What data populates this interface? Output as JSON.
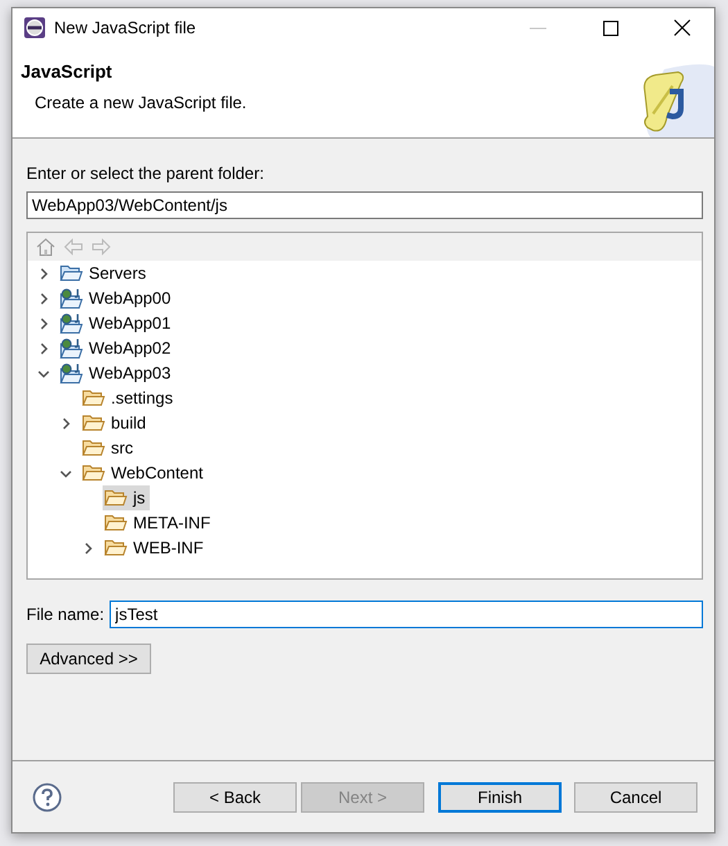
{
  "window": {
    "title": "New JavaScript file",
    "minimize_disabled": true
  },
  "header": {
    "title": "JavaScript",
    "description": "Create a new JavaScript file."
  },
  "parent_folder": {
    "label": "Enter or select the parent folder:",
    "value": "WebApp03/WebContent/js"
  },
  "tree": [
    {
      "name": "Servers",
      "kind": "server_folder",
      "expanded": false,
      "selected": false
    },
    {
      "name": "WebApp00",
      "kind": "project",
      "expanded": false,
      "selected": false
    },
    {
      "name": "WebApp01",
      "kind": "project",
      "expanded": false,
      "selected": false
    },
    {
      "name": "WebApp02",
      "kind": "project",
      "expanded": false,
      "selected": false
    },
    {
      "name": "WebApp03",
      "kind": "project",
      "expanded": true,
      "selected": false,
      "children": [
        {
          "name": ".settings",
          "kind": "folder",
          "selected": false
        },
        {
          "name": "build",
          "kind": "folder",
          "expanded": false,
          "selected": false
        },
        {
          "name": "src",
          "kind": "folder",
          "selected": false
        },
        {
          "name": "WebContent",
          "kind": "folder",
          "expanded": true,
          "selected": false,
          "children": [
            {
              "name": "js",
              "kind": "folder",
              "selected": true
            },
            {
              "name": "META-INF",
              "kind": "folder",
              "selected": false
            },
            {
              "name": "WEB-INF",
              "kind": "folder",
              "expanded": false,
              "selected": false
            }
          ]
        }
      ]
    }
  ],
  "file_name": {
    "label": "File name:",
    "value": "jsTest",
    "focused": true
  },
  "advanced_button": "Advanced >>",
  "buttons": [
    {
      "label": "< Back",
      "disabled": false,
      "default": false
    },
    {
      "label": "Next >",
      "disabled": true,
      "default": false
    },
    {
      "label": "Finish",
      "disabled": false,
      "default": true
    },
    {
      "label": "Cancel",
      "disabled": false,
      "default": false
    }
  ]
}
